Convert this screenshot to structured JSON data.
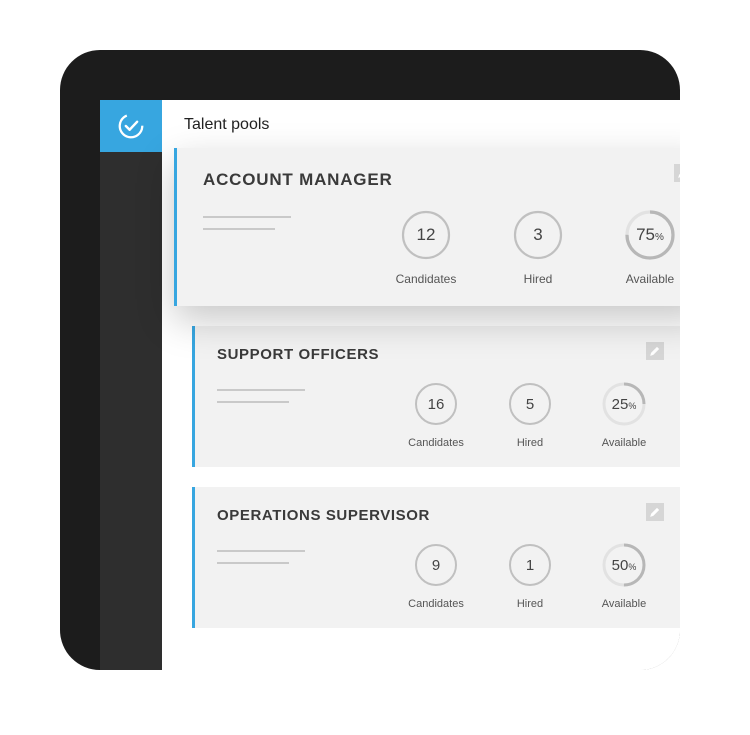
{
  "colors": {
    "accent": "#37a6e0",
    "sidebar": "#2e2e2e",
    "card_bg": "#f2f2f2"
  },
  "page": {
    "title": "Talent pools"
  },
  "pools": [
    {
      "title": "ACCOUNT MANAGER",
      "elevated": true,
      "stats": {
        "candidates": {
          "value": "12",
          "label": "Candidates"
        },
        "hired": {
          "value": "3",
          "label": "Hired"
        },
        "available": {
          "value": "75",
          "label": "Available",
          "percent": 75
        }
      }
    },
    {
      "title": "SUPPORT OFFICERS",
      "elevated": false,
      "stats": {
        "candidates": {
          "value": "16",
          "label": "Candidates"
        },
        "hired": {
          "value": "5",
          "label": "Hired"
        },
        "available": {
          "value": "25",
          "label": "Available",
          "percent": 25
        }
      }
    },
    {
      "title": "OPERATIONS SUPERVISOR",
      "elevated": false,
      "stats": {
        "candidates": {
          "value": "9",
          "label": "Candidates"
        },
        "hired": {
          "value": "1",
          "label": "Hired"
        },
        "available": {
          "value": "50",
          "label": "Available",
          "percent": 50
        }
      }
    }
  ],
  "pct_symbol": "%"
}
